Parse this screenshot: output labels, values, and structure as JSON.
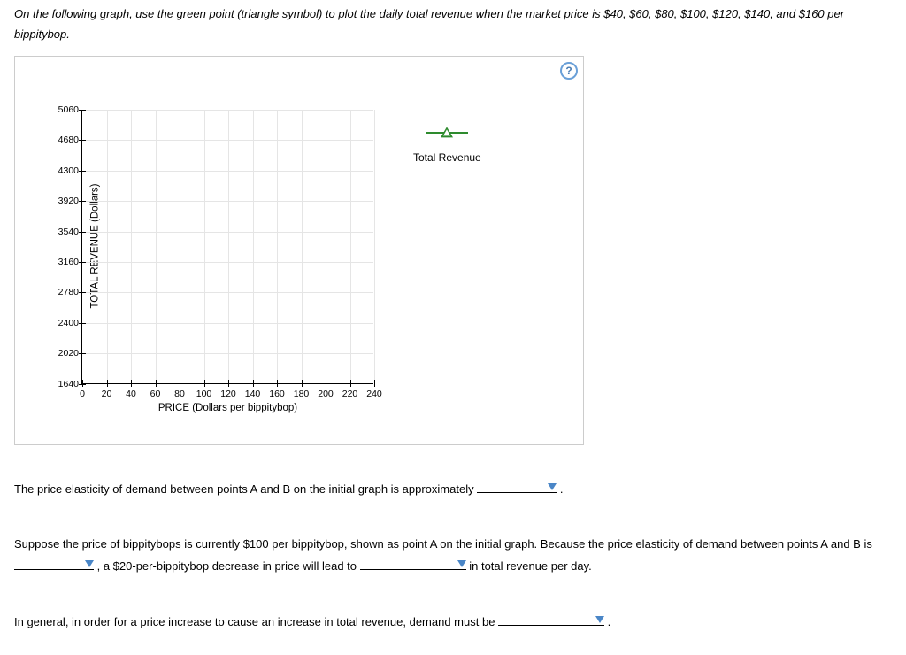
{
  "instruction": "On the following graph, use the green point (triangle symbol) to plot the daily total revenue when the market price is $40, $60, $80, $100, $120, $140, and $160 per bippitybop.",
  "help_label": "?",
  "chart_data": {
    "type": "scatter",
    "title": "",
    "xlabel": "PRICE (Dollars per bippitybop)",
    "ylabel": "TOTAL REVENUE (Dollars)",
    "x_ticks": [
      0,
      20,
      40,
      60,
      80,
      100,
      120,
      140,
      160,
      180,
      200,
      220,
      240
    ],
    "y_ticks": [
      1640,
      2020,
      2400,
      2780,
      3160,
      3540,
      3920,
      4300,
      4680,
      5060
    ],
    "xlim": [
      0,
      240
    ],
    "ylim": [
      1640,
      5060
    ],
    "grid": true,
    "series": [
      {
        "name": "Total Revenue",
        "symbol": "triangle",
        "color": "#2e8b2e",
        "x": [],
        "y": []
      }
    ],
    "legend_position": "right"
  },
  "q1_pre": "The price elasticity of demand between points A and B on the initial graph is approximately ",
  "q1_post": " .",
  "q2_pre": "Suppose the price of bippitybops is currently $100 per bippitybop, shown as point A on the initial graph. Because the price elasticity of demand between points A and B is ",
  "q2_mid": " , a $20-per-bippitybop decrease in price will lead to ",
  "q2_post": " in total revenue per day.",
  "q3_pre": "In general, in order for a price increase to cause an increase in total revenue, demand must be ",
  "q3_post": " ."
}
